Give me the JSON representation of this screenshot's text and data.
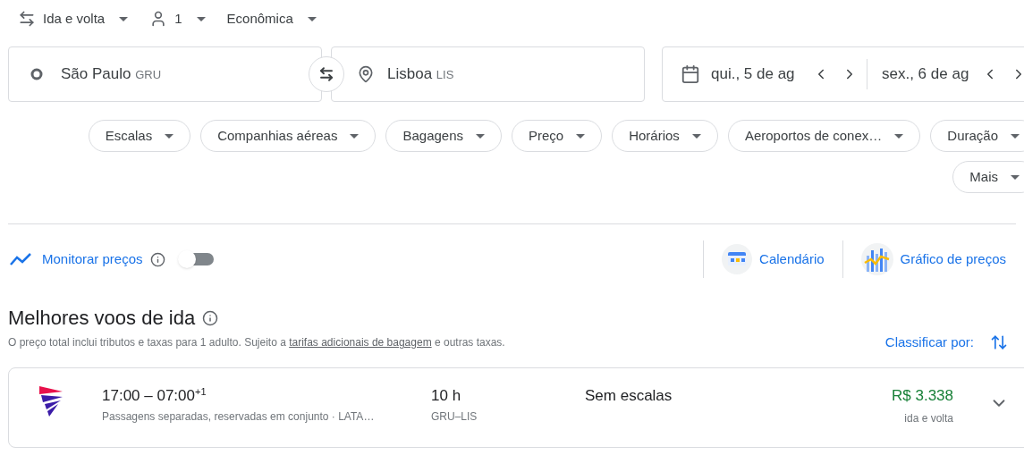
{
  "trip_options": [
    {
      "kind": "trip",
      "label": "Ida e volta"
    },
    {
      "kind": "passengers",
      "label": "1"
    },
    {
      "kind": "class",
      "label": "Econômica"
    }
  ],
  "origin": {
    "city": "São Paulo",
    "code": "GRU"
  },
  "destination": {
    "city": "Lisboa",
    "code": "LIS"
  },
  "dates": {
    "departure": "qui., 5 de ag",
    "return": "sex., 6 de ag"
  },
  "filters": [
    "Escalas",
    "Companhias aéreas",
    "Bagagens",
    "Preço",
    "Horários",
    "Aeroportos de conex…",
    "Duração",
    "Mais"
  ],
  "track_prices": {
    "label": "Monitorar preços",
    "on": false
  },
  "views": [
    {
      "kind": "calendar",
      "label": "Calendário"
    },
    {
      "kind": "chart",
      "label": "Gráfico de preços"
    }
  ],
  "results": {
    "title": "Melhores voos de ida",
    "note": "O preço total inclui tributos e taxas para 1 adulto. Sujeito a ",
    "note_link": "tarifas adicionais de bagagem",
    "note_end": " e outras taxas.",
    "sort_label": "Classificar por:",
    "flights": [
      {
        "times": "17:00 – 07:00",
        "day_offset": "+1",
        "details": "Passagens separadas, reservadas em conjunto · LATA…",
        "duration": "10 h",
        "route": "GRU–LIS",
        "stops": "Sem escalas",
        "price": "R$ 3.338",
        "price_note": "ida e volta"
      }
    ]
  }
}
